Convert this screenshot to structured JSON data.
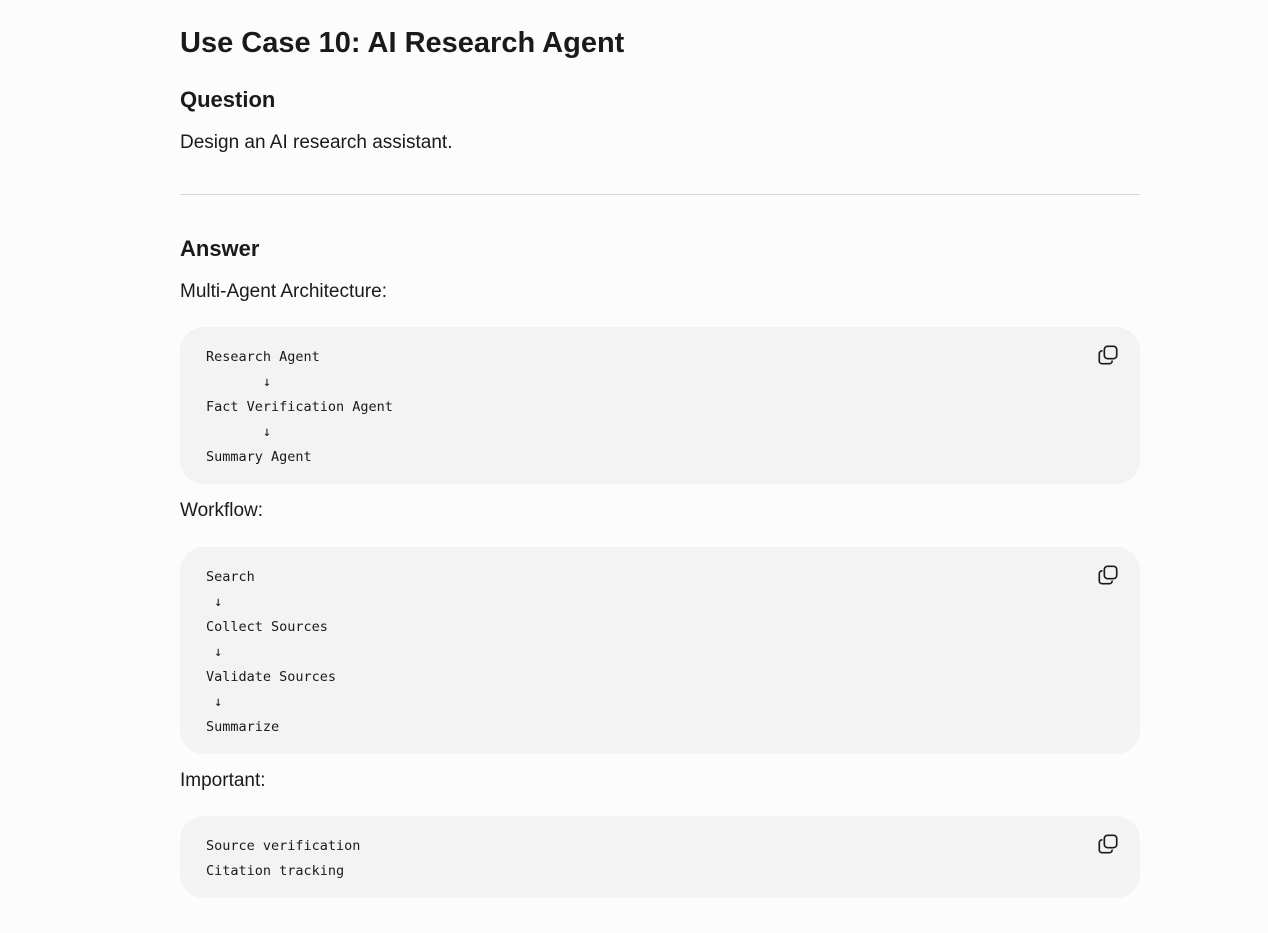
{
  "title": "Use Case 10: AI Research Agent",
  "question": {
    "heading": "Question",
    "text": "Design an AI research assistant."
  },
  "answer": {
    "heading": "Answer",
    "blocks": [
      {
        "label": "Multi-Agent Architecture:",
        "code": "Research Agent\n       ↓\nFact Verification Agent\n       ↓\nSummary Agent"
      },
      {
        "label": "Workflow:",
        "code": "Search\n ↓\nCollect Sources\n ↓\nValidate Sources\n ↓\nSummarize"
      },
      {
        "label": "Important:",
        "code": "Source verification\nCitation tracking"
      }
    ]
  },
  "icons": {
    "copy": "copy-icon"
  }
}
